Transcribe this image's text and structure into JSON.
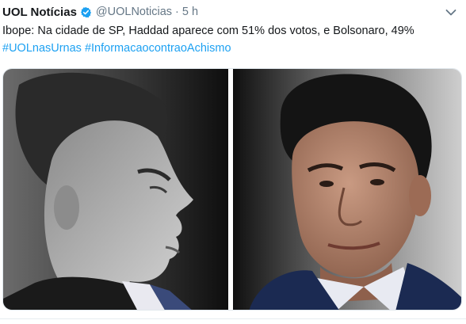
{
  "tweet": {
    "display_name": "UOL Notícias",
    "handle": "@UOLNoticias",
    "separator": "·",
    "time": "5 h",
    "text": "Ibope: Na cidade de SP, Haddad aparece com 51% dos votos, e Bolsonaro, 49%",
    "hashtags": [
      "#UOLnasUrnas",
      "#InformacaocontraoAchismo"
    ]
  },
  "icons": {
    "verified": "verified-badge-icon",
    "more": "chevron-down-icon"
  },
  "colors": {
    "text": "#14171a",
    "muted": "#657786",
    "link": "#1da1f2",
    "verified": "#1da1f2"
  }
}
